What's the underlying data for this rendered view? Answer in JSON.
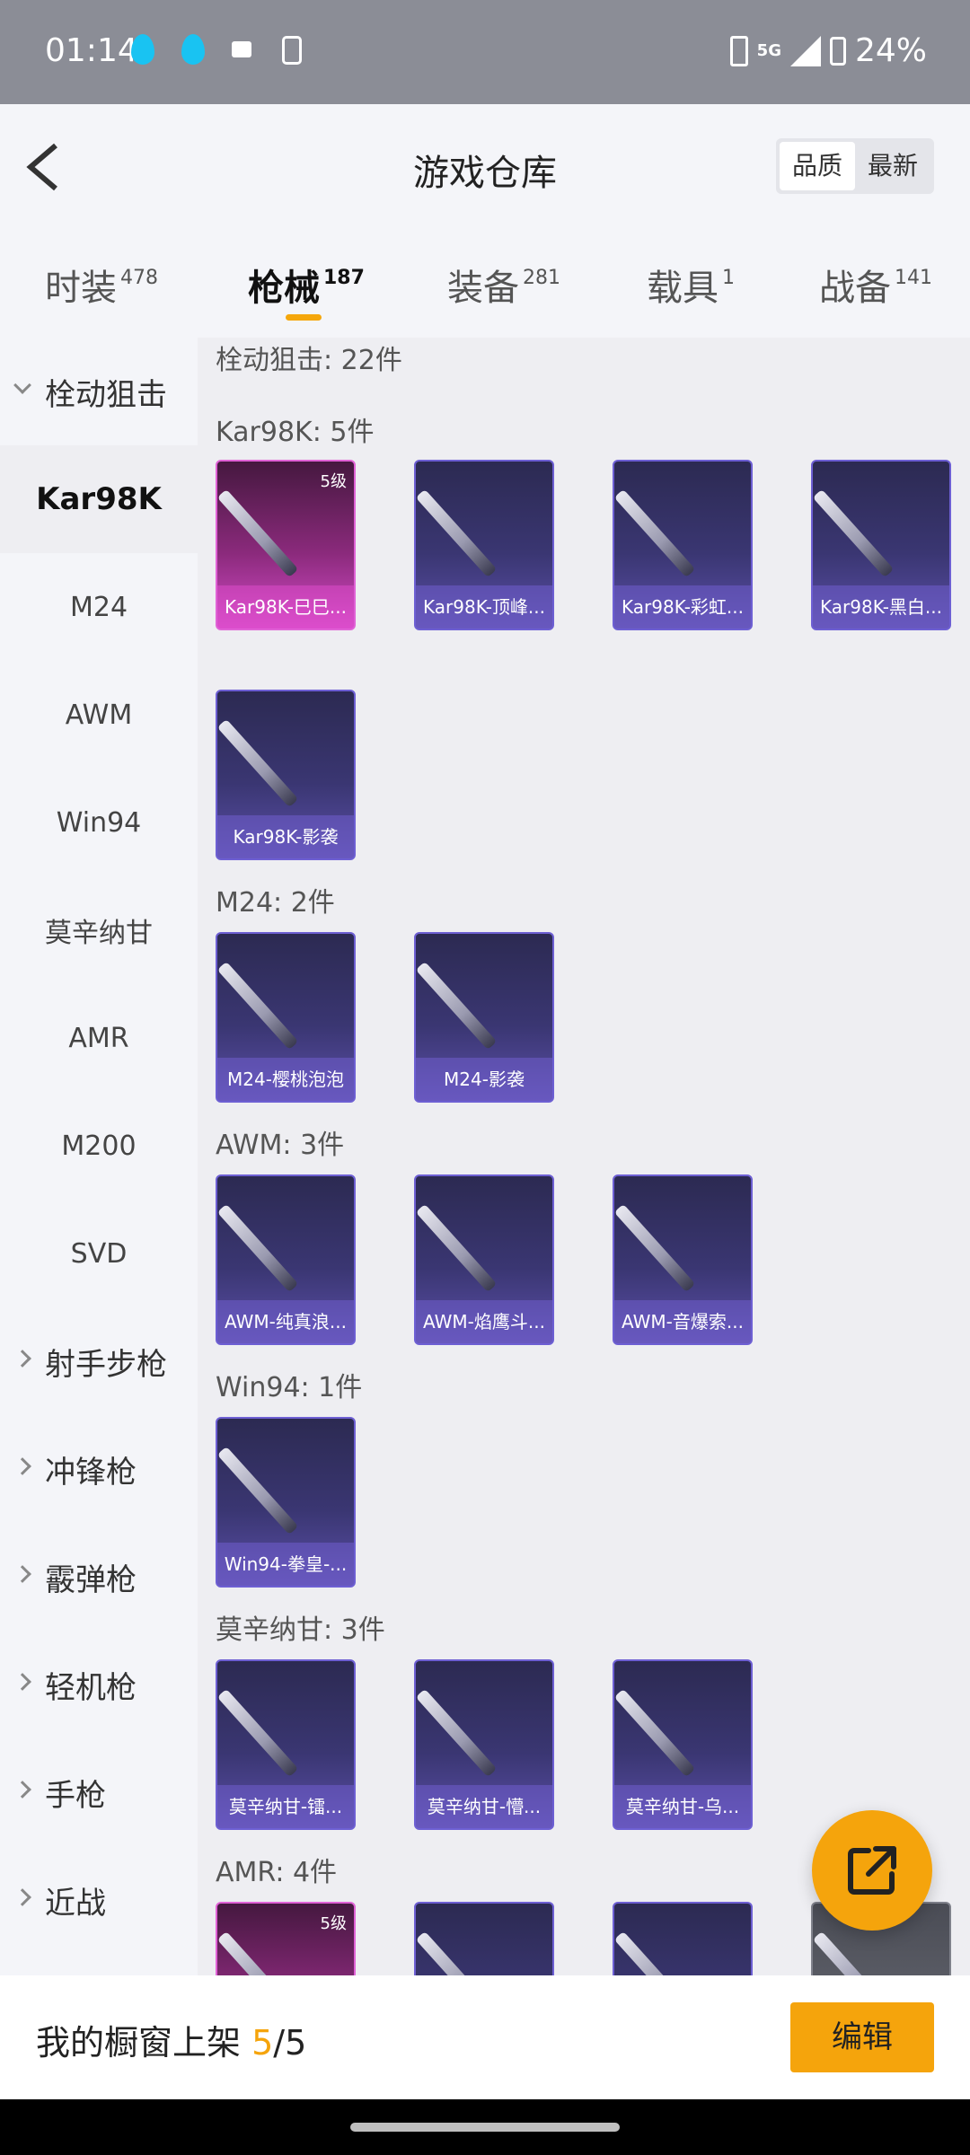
{
  "status": {
    "time": "01:14",
    "network": "5G",
    "battery": "24%"
  },
  "header": {
    "title": "游戏仓库",
    "sort_options": [
      "品质",
      "最新"
    ]
  },
  "tabs": [
    {
      "label": "时装",
      "count": "478"
    },
    {
      "label": "枪械",
      "count": "187"
    },
    {
      "label": "装备",
      "count": "281"
    },
    {
      "label": "载具",
      "count": "1"
    },
    {
      "label": "战备",
      "count": "141"
    }
  ],
  "sidebar": {
    "groups": [
      "栓动狙击",
      "射手步枪",
      "冲锋枪",
      "霰弹枪",
      "轻机枪",
      "手枪",
      "近战"
    ],
    "items": [
      "Kar98K",
      "M24",
      "AWM",
      "Win94",
      "莫辛纳甘",
      "AMR",
      "M200",
      "SVD"
    ]
  },
  "content": {
    "category_header": "栓动狙击: 22件",
    "sections": [
      {
        "title": "Kar98K: 5件",
        "items": [
          "Kar98K-巳巳...",
          "Kar98K-顶峰...",
          "Kar98K-彩虹...",
          "Kar98K-黑白...",
          "Kar98K-影袭"
        ]
      },
      {
        "title": "M24: 2件",
        "items": [
          "M24-樱桃泡泡",
          "M24-影袭"
        ]
      },
      {
        "title": "AWM: 3件",
        "items": [
          "AWM-纯真浪...",
          "AWM-焰鹰斗...",
          "AWM-音爆索..."
        ]
      },
      {
        "title": "Win94: 1件",
        "items": [
          "Win94-拳皇-..."
        ]
      },
      {
        "title": "莫辛纳甘: 3件",
        "items": [
          "莫辛纳甘-镭...",
          "莫辛纳甘-懵...",
          "莫辛纳甘-乌..."
        ]
      },
      {
        "title": "AMR: 4件"
      }
    ],
    "level_badge": "5级"
  },
  "bottom": {
    "label": "我的橱窗上架",
    "current": "5",
    "total": "/5",
    "edit": "编辑"
  }
}
